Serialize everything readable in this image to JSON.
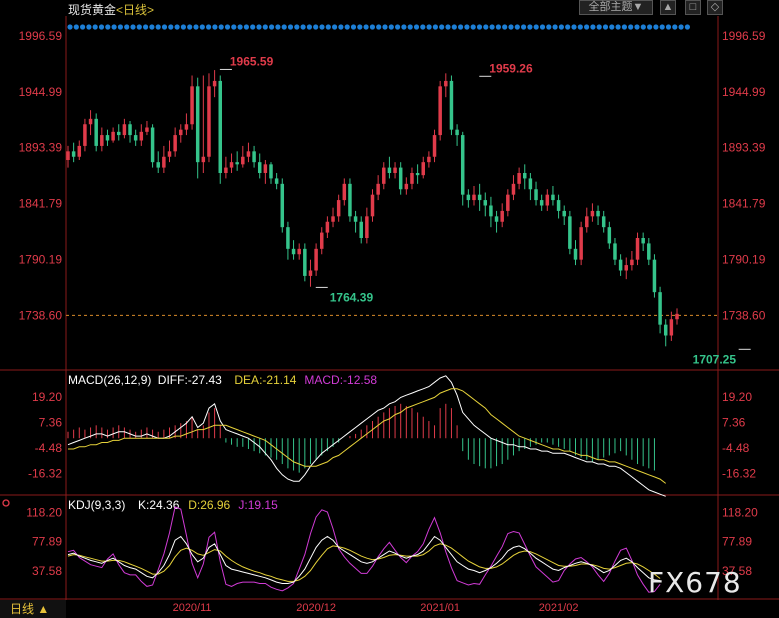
{
  "header": {
    "title": "现货黄金",
    "period": "<日线>",
    "menu_label": "全部主题▼",
    "btn_up": "▲",
    "btn_a": "□",
    "btn_b": "◇"
  },
  "bottom_tab": "日线 ▲",
  "watermark": "FX678",
  "colors": {
    "up": "#e03b4a",
    "down": "#35c48b",
    "bg": "#000000",
    "axis": "#e03b4a",
    "diff": "#ffffff",
    "dea": "#e6d23a",
    "macd": "#d13bd6"
  },
  "chart_data": [
    {
      "type": "candlestick",
      "title": "现货黄金 <日线>",
      "y_ticks": [
        "1996.59",
        "1944.99",
        "1893.39",
        "1841.79",
        "1790.19",
        "1738.60"
      ],
      "ylim": [
        1690,
        2002
      ],
      "last_price": "1738.60",
      "annotations": [
        {
          "label": "1965.59",
          "x_index": 28,
          "value": 1965.59
        },
        {
          "label": "1959.26",
          "x_index": 74,
          "value": 1959.26
        },
        {
          "label": "1764.39",
          "x_index": 45,
          "value": 1764.39
        },
        {
          "label": "1707.25",
          "x_index": 120,
          "value": 1707.25
        }
      ],
      "x_ticks": [
        {
          "label": "2020/11",
          "index": 22
        },
        {
          "label": "2020/12",
          "index": 44
        },
        {
          "label": "2021/01",
          "index": 66
        },
        {
          "label": "2021/02",
          "index": 87
        }
      ],
      "candles": [
        [
          1882,
          1890,
          1875,
          1895
        ],
        [
          1890,
          1885,
          1880,
          1898
        ],
        [
          1885,
          1895,
          1882,
          1900
        ],
        [
          1895,
          1915,
          1890,
          1920
        ],
        [
          1915,
          1920,
          1905,
          1928
        ],
        [
          1920,
          1895,
          1890,
          1925
        ],
        [
          1895,
          1905,
          1890,
          1912
        ],
        [
          1905,
          1900,
          1895,
          1910
        ],
        [
          1900,
          1908,
          1898,
          1912
        ],
        [
          1908,
          1905,
          1900,
          1915
        ],
        [
          1905,
          1915,
          1902,
          1920
        ],
        [
          1915,
          1905,
          1898,
          1918
        ],
        [
          1905,
          1900,
          1895,
          1910
        ],
        [
          1900,
          1908,
          1895,
          1915
        ],
        [
          1908,
          1912,
          1905,
          1918
        ],
        [
          1912,
          1880,
          1875,
          1915
        ],
        [
          1880,
          1875,
          1870,
          1890
        ],
        [
          1875,
          1885,
          1870,
          1895
        ],
        [
          1885,
          1890,
          1880,
          1900
        ],
        [
          1890,
          1905,
          1885,
          1912
        ],
        [
          1905,
          1910,
          1898,
          1915
        ],
        [
          1910,
          1915,
          1905,
          1925
        ],
        [
          1915,
          1950,
          1910,
          1960
        ],
        [
          1950,
          1880,
          1865,
          1958
        ],
        [
          1880,
          1885,
          1870,
          1960
        ],
        [
          1885,
          1950,
          1880,
          1962
        ],
        [
          1950,
          1955,
          1940,
          1965
        ],
        [
          1955,
          1870,
          1860,
          1960
        ],
        [
          1870,
          1875,
          1865,
          1885
        ],
        [
          1875,
          1880,
          1870,
          1888
        ],
        [
          1880,
          1878,
          1872,
          1890
        ],
        [
          1878,
          1885,
          1875,
          1895
        ],
        [
          1885,
          1890,
          1880,
          1898
        ],
        [
          1890,
          1880,
          1875,
          1895
        ],
        [
          1880,
          1870,
          1865,
          1888
        ],
        [
          1870,
          1878,
          1860,
          1882
        ],
        [
          1878,
          1865,
          1860,
          1880
        ],
        [
          1865,
          1860,
          1855,
          1870
        ],
        [
          1860,
          1820,
          1815,
          1865
        ],
        [
          1820,
          1800,
          1790,
          1825
        ],
        [
          1800,
          1795,
          1790,
          1808
        ],
        [
          1795,
          1800,
          1790,
          1805
        ],
        [
          1800,
          1775,
          1770,
          1805
        ],
        [
          1775,
          1780,
          1765,
          1790
        ],
        [
          1780,
          1800,
          1775,
          1805
        ],
        [
          1800,
          1815,
          1795,
          1820
        ],
        [
          1815,
          1825,
          1810,
          1830
        ],
        [
          1825,
          1830,
          1820,
          1838
        ],
        [
          1830,
          1845,
          1825,
          1850
        ],
        [
          1845,
          1860,
          1840,
          1865
        ],
        [
          1860,
          1830,
          1825,
          1865
        ],
        [
          1830,
          1825,
          1815,
          1835
        ],
        [
          1825,
          1810,
          1805,
          1830
        ],
        [
          1810,
          1830,
          1805,
          1838
        ],
        [
          1830,
          1850,
          1825,
          1855
        ],
        [
          1850,
          1860,
          1845,
          1868
        ],
        [
          1860,
          1875,
          1855,
          1880
        ],
        [
          1875,
          1870,
          1865,
          1885
        ],
        [
          1870,
          1875,
          1865,
          1880
        ],
        [
          1875,
          1855,
          1850,
          1880
        ],
        [
          1855,
          1860,
          1850,
          1866
        ],
        [
          1860,
          1870,
          1855,
          1875
        ],
        [
          1870,
          1868,
          1860,
          1878
        ],
        [
          1868,
          1880,
          1865,
          1885
        ],
        [
          1880,
          1885,
          1875,
          1890
        ],
        [
          1885,
          1905,
          1880,
          1910
        ],
        [
          1905,
          1950,
          1900,
          1955
        ],
        [
          1950,
          1955,
          1940,
          1962
        ],
        [
          1955,
          1910,
          1905,
          1960
        ],
        [
          1910,
          1905,
          1895,
          1915
        ],
        [
          1905,
          1850,
          1840,
          1908
        ],
        [
          1850,
          1845,
          1838,
          1855
        ],
        [
          1845,
          1850,
          1840,
          1858
        ],
        [
          1850,
          1845,
          1835,
          1860
        ],
        [
          1845,
          1840,
          1830,
          1852
        ],
        [
          1840,
          1830,
          1820,
          1848
        ],
        [
          1830,
          1825,
          1815,
          1835
        ],
        [
          1825,
          1835,
          1820,
          1842
        ],
        [
          1835,
          1850,
          1830,
          1855
        ],
        [
          1850,
          1860,
          1845,
          1868
        ],
        [
          1860,
          1870,
          1855,
          1875
        ],
        [
          1870,
          1865,
          1855,
          1878
        ],
        [
          1865,
          1855,
          1845,
          1870
        ],
        [
          1855,
          1845,
          1840,
          1862
        ],
        [
          1845,
          1840,
          1835,
          1850
        ],
        [
          1840,
          1850,
          1835,
          1855
        ],
        [
          1850,
          1845,
          1840,
          1858
        ],
        [
          1845,
          1835,
          1828,
          1850
        ],
        [
          1835,
          1830,
          1822,
          1840
        ],
        [
          1830,
          1800,
          1795,
          1835
        ],
        [
          1800,
          1790,
          1785,
          1808
        ],
        [
          1790,
          1820,
          1785,
          1825
        ],
        [
          1820,
          1830,
          1815,
          1838
        ],
        [
          1830,
          1835,
          1825,
          1842
        ],
        [
          1835,
          1830,
          1822,
          1840
        ],
        [
          1830,
          1820,
          1815,
          1835
        ],
        [
          1820,
          1805,
          1800,
          1825
        ],
        [
          1805,
          1790,
          1785,
          1810
        ],
        [
          1790,
          1780,
          1775,
          1795
        ],
        [
          1780,
          1785,
          1772,
          1792
        ],
        [
          1785,
          1790,
          1780,
          1798
        ],
        [
          1790,
          1810,
          1785,
          1815
        ],
        [
          1810,
          1805,
          1798,
          1815
        ],
        [
          1805,
          1790,
          1785,
          1810
        ],
        [
          1790,
          1760,
          1755,
          1795
        ],
        [
          1760,
          1730,
          1722,
          1765
        ],
        [
          1730,
          1720,
          1710,
          1735
        ],
        [
          1720,
          1735,
          1715,
          1742
        ],
        [
          1735,
          1740,
          1730,
          1745
        ]
      ]
    },
    {
      "type": "macd",
      "label": "MACD(26,12,9)",
      "diff_label": "DIFF:-27.43",
      "dea_label": "DEA:-21.14",
      "macd_label": "MACD:-12.58",
      "y_ticks": [
        "19.20",
        "7.36",
        "-4.48",
        "-16.32"
      ],
      "ylim": [
        -25,
        28
      ],
      "hist": [
        3,
        4,
        5,
        4,
        5,
        6,
        5,
        4,
        5,
        6,
        5,
        4,
        3,
        4,
        5,
        4,
        3,
        4,
        5,
        6,
        7,
        8,
        10,
        4,
        6,
        12,
        14,
        6,
        -2,
        -3,
        -4,
        -4,
        -5,
        -6,
        -7,
        -8,
        -9,
        -10,
        -12,
        -14,
        -15,
        -16,
        -14,
        -12,
        -10,
        -8,
        -6,
        -4,
        -2,
        0,
        1,
        2,
        4,
        6,
        8,
        10,
        12,
        14,
        15,
        16,
        15,
        14,
        12,
        10,
        8,
        6,
        14,
        16,
        14,
        6,
        -6,
        -10,
        -12,
        -13,
        -14,
        -14,
        -13,
        -12,
        -10,
        -8,
        -6,
        -5,
        -4,
        -3,
        -2,
        -2,
        -3,
        -4,
        -5,
        -6,
        -8,
        -9,
        -10,
        -11,
        -10,
        -9,
        -8,
        -7,
        -6,
        -8,
        -10,
        -12,
        -13,
        -14,
        -15
      ],
      "diff": [
        -3,
        -2,
        -1,
        0,
        1,
        2,
        2,
        1,
        2,
        3,
        3,
        2,
        1,
        1,
        2,
        1,
        0,
        0,
        1,
        3,
        5,
        7,
        10,
        5,
        7,
        14,
        16,
        8,
        4,
        3,
        2,
        1,
        0,
        -2,
        -4,
        -7,
        -10,
        -14,
        -17,
        -19,
        -20,
        -20,
        -17,
        -13,
        -10,
        -7,
        -5,
        -3,
        -1,
        1,
        3,
        5,
        7,
        9,
        11,
        13,
        14,
        16,
        17,
        19,
        20,
        21,
        22,
        23,
        24,
        26,
        28,
        29,
        26,
        20,
        12,
        9,
        6,
        4,
        2,
        0,
        -1,
        -2,
        -3,
        -3,
        -4,
        -4,
        -5,
        -5,
        -6,
        -6,
        -7,
        -7,
        -7,
        -8,
        -9,
        -10,
        -11,
        -11,
        -12,
        -12,
        -13,
        -13,
        -14,
        -16,
        -18,
        -20,
        -22,
        -24,
        -25,
        -26,
        -27
      ],
      "dea": [
        -5,
        -5,
        -4,
        -4,
        -3,
        -3,
        -2,
        -2,
        -1,
        -1,
        0,
        0,
        0,
        0,
        0,
        0,
        0,
        0,
        0,
        1,
        1,
        2,
        3,
        4,
        4,
        5,
        6,
        6,
        6,
        5,
        4,
        3,
        2,
        1,
        0,
        -1,
        -3,
        -5,
        -7,
        -9,
        -11,
        -12,
        -13,
        -13,
        -13,
        -12,
        -11,
        -9,
        -8,
        -6,
        -4,
        -2,
        0,
        2,
        4,
        6,
        8,
        9,
        11,
        12,
        14,
        15,
        16,
        17,
        18,
        19,
        21,
        22,
        23,
        23,
        22,
        20,
        18,
        16,
        14,
        11,
        9,
        7,
        5,
        3,
        1,
        0,
        -1,
        -2,
        -3,
        -4,
        -5,
        -5,
        -6,
        -6,
        -7,
        -8,
        -8,
        -9,
        -10,
        -10,
        -11,
        -11,
        -12,
        -13,
        -14,
        -15,
        -16,
        -17,
        -18,
        -19,
        -21
      ]
    },
    {
      "type": "kdj",
      "label": "KDJ(9,3,3)",
      "k_label": "K:24.36",
      "d_label": "D:26.96",
      "j_label": "J:19.15",
      "y_ticks": [
        "118.20",
        "77.89",
        "37.58"
      ],
      "ylim": [
        0,
        130
      ],
      "k": [
        60,
        62,
        58,
        55,
        52,
        50,
        48,
        52,
        55,
        50,
        45,
        42,
        40,
        35,
        30,
        28,
        35,
        45,
        60,
        80,
        85,
        75,
        60,
        50,
        55,
        70,
        75,
        60,
        45,
        40,
        38,
        36,
        34,
        32,
        30,
        28,
        25,
        22,
        20,
        20,
        22,
        30,
        40,
        55,
        70,
        80,
        85,
        80,
        70,
        65,
        60,
        55,
        50,
        48,
        50,
        55,
        60,
        65,
        62,
        58,
        55,
        58,
        60,
        65,
        75,
        85,
        80,
        70,
        60,
        50,
        45,
        40,
        38,
        35,
        38,
        42,
        48,
        55,
        65,
        70,
        72,
        68,
        62,
        55,
        50,
        45,
        40,
        38,
        42,
        45,
        48,
        50,
        48,
        45,
        40,
        35,
        38,
        45,
        52,
        55,
        50,
        42,
        35,
        28,
        25,
        24
      ],
      "d": [
        58,
        60,
        59,
        57,
        55,
        53,
        51,
        51,
        52,
        52,
        50,
        47,
        44,
        41,
        37,
        33,
        33,
        37,
        45,
        57,
        66,
        69,
        66,
        61,
        59,
        63,
        67,
        65,
        58,
        52,
        47,
        43,
        40,
        37,
        35,
        32,
        30,
        27,
        25,
        23,
        23,
        25,
        30,
        38,
        49,
        59,
        68,
        72,
        71,
        69,
        66,
        62,
        58,
        55,
        53,
        54,
        56,
        59,
        60,
        59,
        58,
        58,
        58,
        60,
        65,
        72,
        75,
        73,
        69,
        63,
        57,
        51,
        47,
        43,
        41,
        41,
        43,
        47,
        53,
        59,
        63,
        65,
        64,
        61,
        57,
        53,
        49,
        45,
        44,
        44,
        45,
        47,
        47,
        46,
        44,
        41,
        40,
        42,
        45,
        48,
        49,
        47,
        43,
        38,
        33,
        27
      ],
      "j": [
        64,
        66,
        56,
        51,
        46,
        44,
        42,
        54,
        61,
        46,
        35,
        32,
        32,
        23,
        16,
        18,
        39,
        61,
        90,
        126,
        123,
        87,
        48,
        28,
        47,
        84,
        91,
        50,
        19,
        16,
        20,
        22,
        22,
        22,
        20,
        20,
        15,
        12,
        10,
        14,
        20,
        40,
        60,
        89,
        112,
        122,
        119,
        96,
        68,
        57,
        48,
        41,
        34,
        34,
        44,
        57,
        68,
        77,
        66,
        56,
        49,
        58,
        64,
        75,
        95,
        111,
        90,
        64,
        42,
        24,
        21,
        18,
        20,
        19,
        32,
        44,
        58,
        71,
        89,
        92,
        90,
        74,
        58,
        43,
        36,
        29,
        22,
        24,
        38,
        47,
        54,
        56,
        50,
        43,
        32,
        23,
        34,
        51,
        66,
        69,
        52,
        32,
        19,
        8,
        9,
        19
      ]
    }
  ]
}
